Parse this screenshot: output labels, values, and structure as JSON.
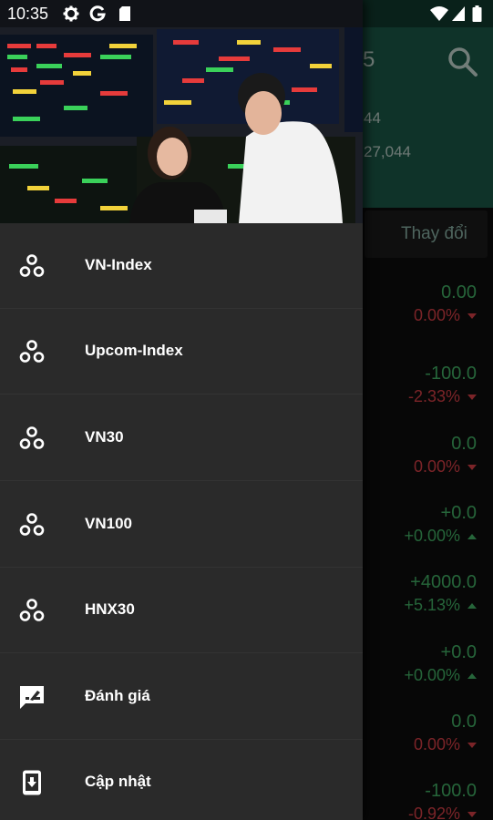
{
  "status_bar": {
    "time": "10:35",
    "icons": [
      "gear-icon",
      "google-icon",
      "sd-card-icon",
      "wifi-icon",
      "signal-icon",
      "battery-icon"
    ]
  },
  "background": {
    "toolbar_title_fragment": "5",
    "header_values": [
      "44",
      "27,044"
    ],
    "tab_change_label": "Thay đổi",
    "quotes": [
      {
        "price": "0.00",
        "pct": "0.00%",
        "dir": "down"
      },
      {
        "price": "-100.0",
        "pct": "-2.33%",
        "dir": "down"
      },
      {
        "price": "0.0",
        "pct": "0.00%",
        "dir": "down"
      },
      {
        "price": "+0.0",
        "pct": "+0.00%",
        "dir": "up"
      },
      {
        "price": "+4000.0",
        "pct": "+5.13%",
        "dir": "up"
      },
      {
        "price": "+0.0",
        "pct": "+0.00%",
        "dir": "up"
      },
      {
        "price": "0.0",
        "pct": "0.00%",
        "dir": "down"
      },
      {
        "price": "-100.0",
        "pct": "-0.92%",
        "dir": "down"
      }
    ]
  },
  "drawer": {
    "items": [
      {
        "label": "VN-Index",
        "icon": "bubbles-icon"
      },
      {
        "label": "Upcom-Index",
        "icon": "bubbles-icon"
      },
      {
        "label": "VN30",
        "icon": "bubbles-icon"
      },
      {
        "label": "VN100",
        "icon": "bubbles-icon"
      },
      {
        "label": "HNX30",
        "icon": "bubbles-icon"
      },
      {
        "label": "Đánh giá",
        "icon": "rate-review-icon"
      },
      {
        "label": "Cập nhật",
        "icon": "system-update-icon"
      }
    ]
  },
  "colors": {
    "toolbar": "#1d5d4c",
    "drawer": "#2a2a2a",
    "positive": "#45b96a",
    "negative": "#e0424a"
  }
}
